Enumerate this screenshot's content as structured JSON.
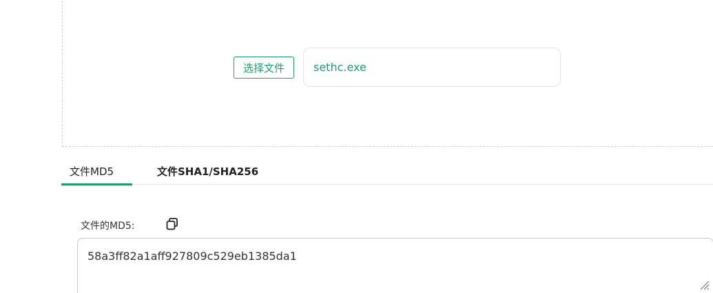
{
  "upload": {
    "choose_label": "选择文件",
    "filename": "sethc.exe"
  },
  "tabs": {
    "md5": "文件MD5",
    "sha": "文件SHA1/SHA256"
  },
  "result": {
    "label": "文件的MD5:",
    "value": "58a3ff82a1aff927809c529eb1385da1"
  },
  "colors": {
    "accent": "#1e9e6a"
  }
}
